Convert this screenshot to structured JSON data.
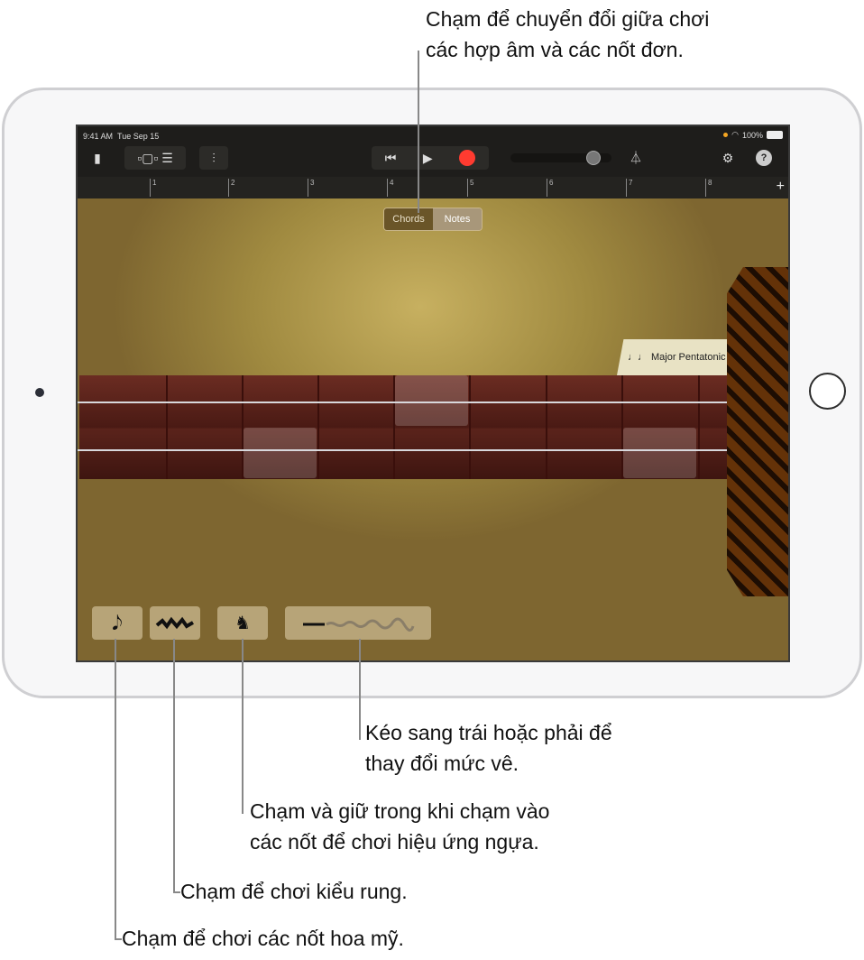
{
  "callouts": {
    "toggle": [
      "Chạm để chuyển đổi giữa chơi",
      "các hợp âm và các nốt đơn."
    ],
    "slider": [
      "Kéo sang trái hoặc phải để",
      "thay đổi mức vê."
    ],
    "horse": [
      "Chạm và giữ trong khi chạm vào",
      "các nốt để chơi hiệu ứng ngựa."
    ],
    "vibrato": "Chạm để chơi kiểu rung.",
    "grace": "Chạm để chơi các nốt hoa mỹ."
  },
  "status": {
    "time": "9:41 AM",
    "date": "Tue Sep 15",
    "battery": "100%"
  },
  "ruler": {
    "marks": [
      "1",
      "2",
      "3",
      "4",
      "5",
      "6",
      "7",
      "8"
    ],
    "add": "+"
  },
  "mode": {
    "chords": "Chords",
    "notes": "Notes",
    "selected": "Notes"
  },
  "scale": {
    "icon": "♩♩",
    "label": "Major Pentatonic"
  },
  "icons": {
    "record_color": "#ff3b30",
    "play": "▶",
    "previous": "⏮",
    "grace": "𝅘𝅥𝅮",
    "help": "?",
    "gear": "⚙"
  }
}
